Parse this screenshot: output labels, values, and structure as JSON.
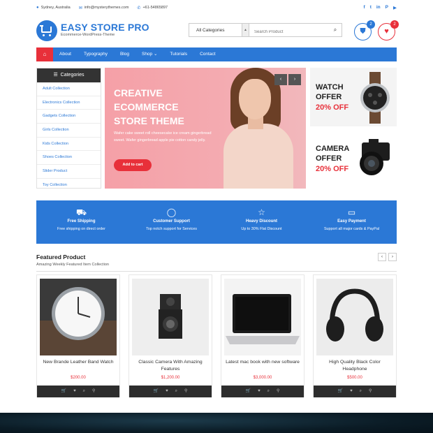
{
  "topbar": {
    "location": "Sydney, Australia",
    "email": "info@mysterythemes.com",
    "phone": "+61-54865897",
    "social": [
      "f",
      "t",
      "in",
      "P",
      "▶"
    ]
  },
  "header": {
    "logo_title": "EASY STORE PRO",
    "logo_subtitle": "Ecommerce-WordPress-Theme",
    "category_select": "All Categories",
    "search_placeholder": "Search Product",
    "cart_count": "2",
    "wishlist_count": "2"
  },
  "nav": {
    "items": [
      "About",
      "Typography",
      "Blog",
      "Shop ⌄",
      "Tutorials",
      "Contact"
    ]
  },
  "categories": {
    "heading": "Categories",
    "items": [
      "Adult Collection",
      "Electronics Collection",
      "Gadgets Collection",
      "Girls Collection",
      "Kids Collection",
      "Shoes Collection",
      "Slider Product",
      "Toy Collection"
    ]
  },
  "hero": {
    "title": "CREATIVE ECOMMERCE STORE THEME",
    "text": "Wafer cake sweet roll cheesecake ice cream gingerbread sweet. Wafer gingerbread apple pie cotton candy jelly.",
    "button": "Add to cart"
  },
  "promos": {
    "watch": {
      "line1": "WATCH",
      "line2": "OFFER",
      "off": "20% OFF"
    },
    "camera": {
      "line1": "CAMERA",
      "line2": "OFFER",
      "off": "20% OFF"
    }
  },
  "features": [
    {
      "title": "Free Shipping",
      "text": "Free shipping on direct order"
    },
    {
      "title": "Customer Support",
      "text": "Top notch support for Services"
    },
    {
      "title": "Heavy Discount",
      "text": "Up to 30% Flat Discount"
    },
    {
      "title": "Easy Payment",
      "text": "Support all major cards & PayPal"
    }
  ],
  "featured": {
    "title": "Featured Product",
    "subtitle": "Amazing Weekly Featured Item Collection",
    "products": [
      {
        "name": "New Brande Leather Band Watch",
        "price": "$200.00"
      },
      {
        "name": "Classic Camera With Amazing Features",
        "price": "$1,200.00"
      },
      {
        "name": "Latest mac book with new software",
        "price": "$3,000.00"
      },
      {
        "name": "High Quality Black Color Headphone",
        "price": "$500.00"
      }
    ]
  },
  "colors": {
    "brand_blue": "#2b78d6",
    "accent_red": "#e8303a",
    "dark": "#333333"
  }
}
